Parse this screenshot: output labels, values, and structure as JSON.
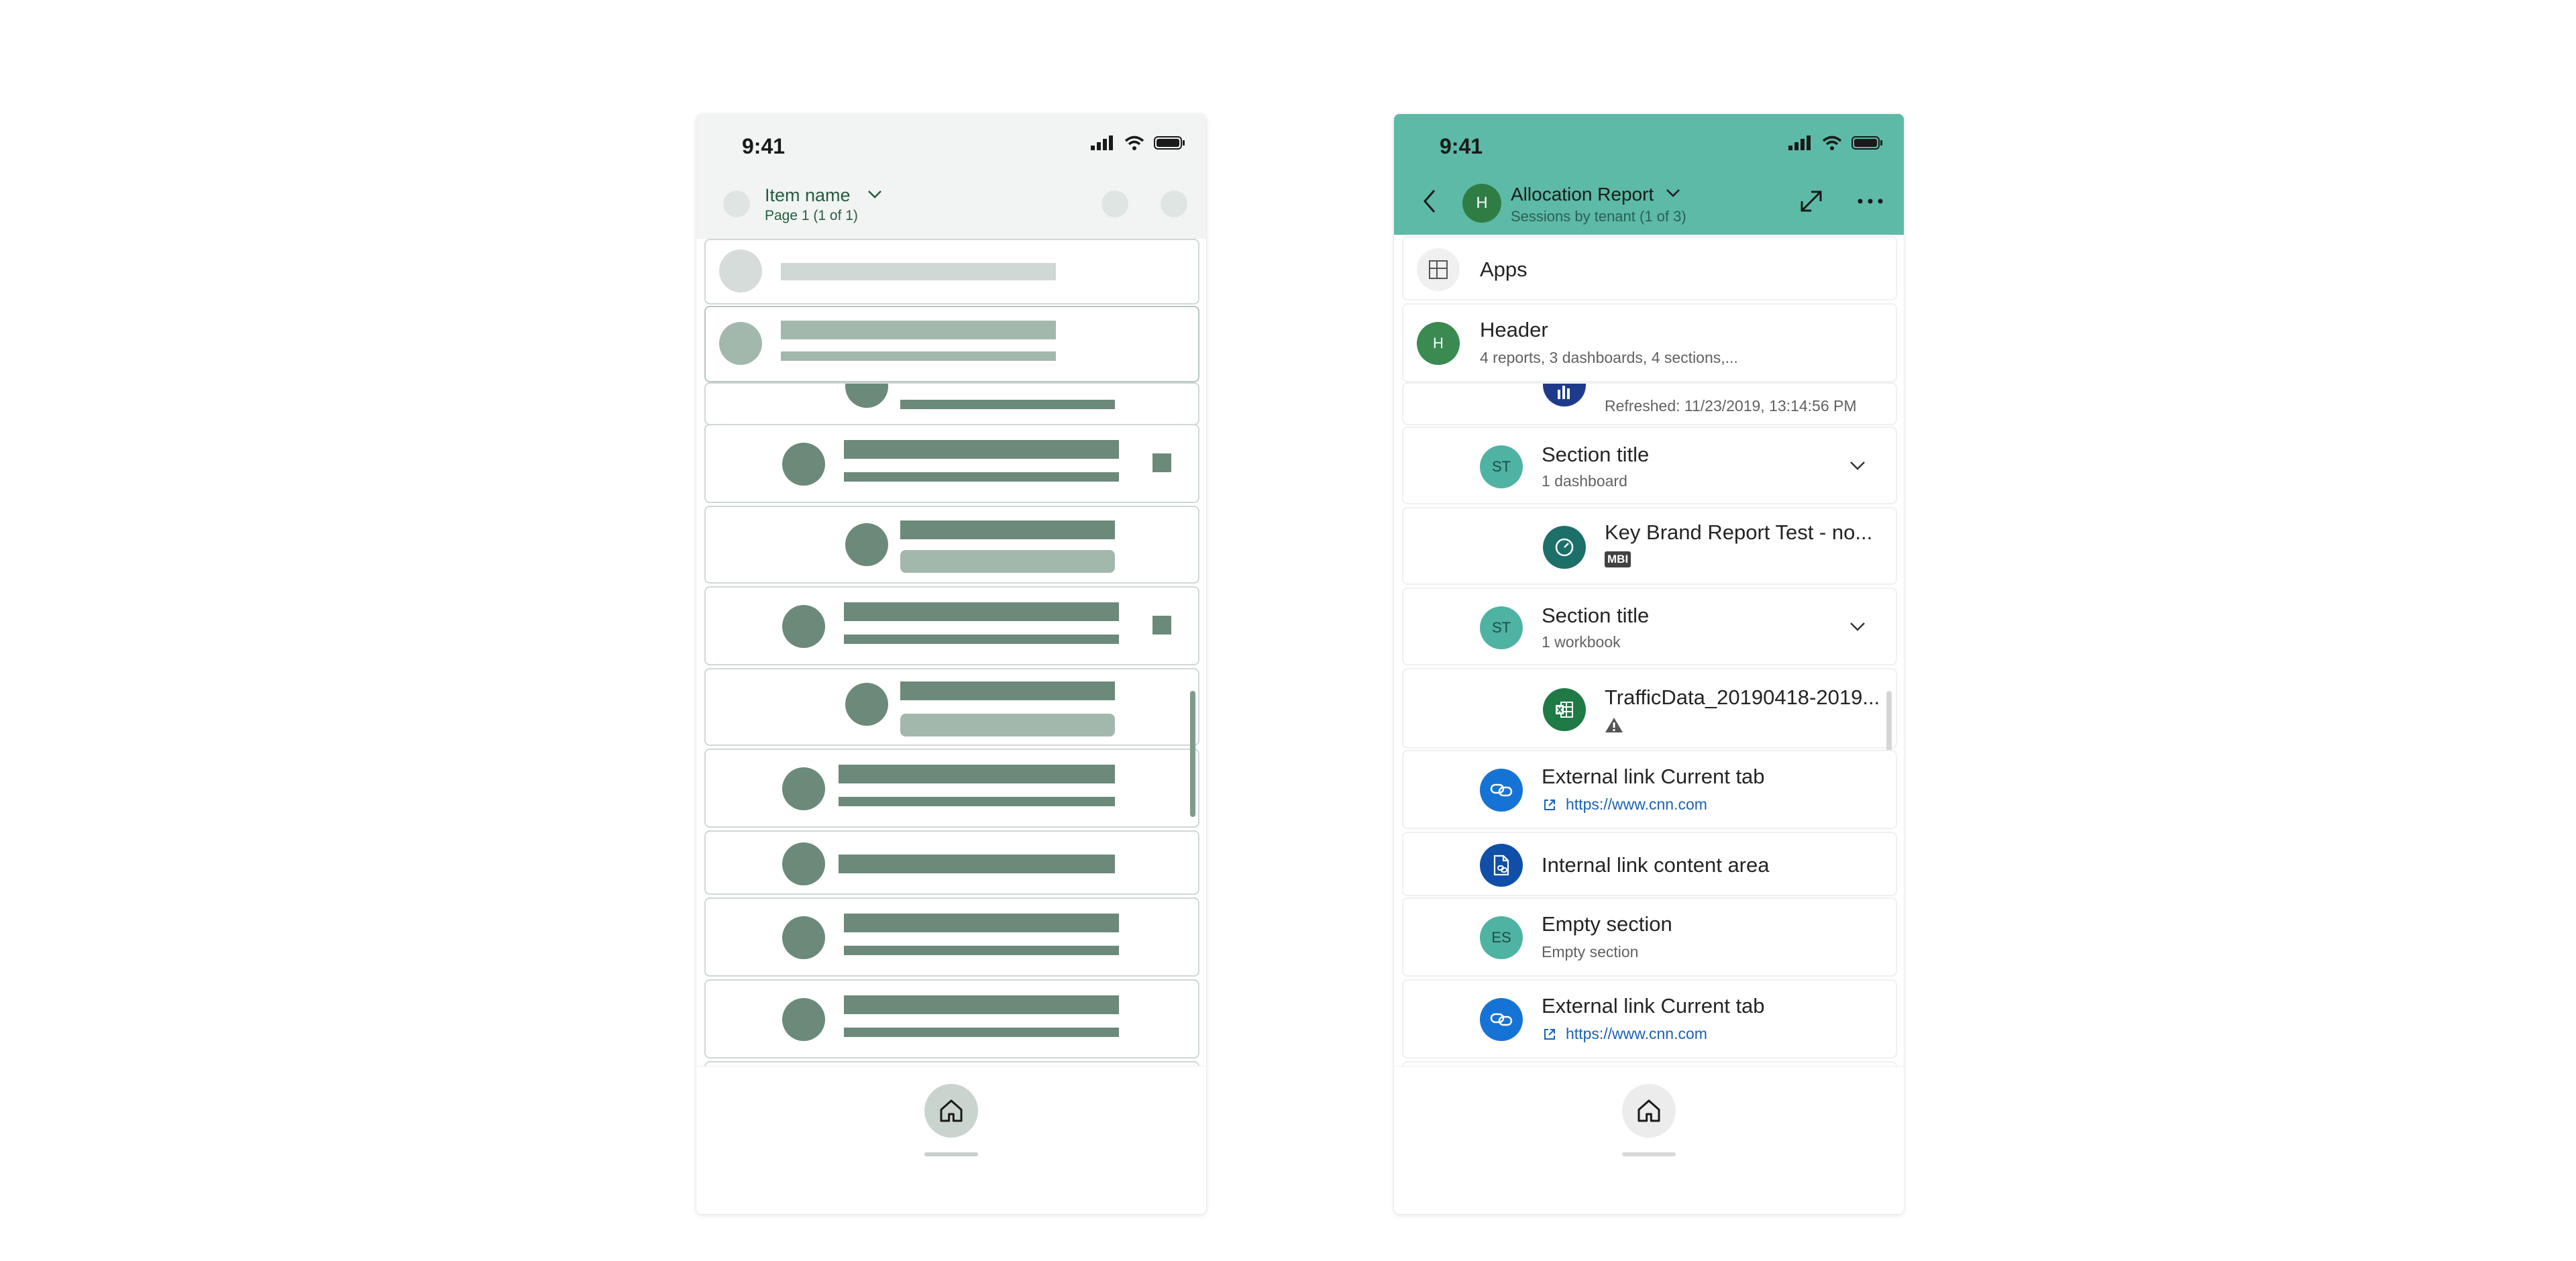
{
  "skeleton": {
    "status_time": "9:41",
    "header_title": "Item name",
    "header_subtitle": "Page 1 (1 of 1)",
    "colors": {
      "header_bg": "#f1f4f3",
      "bar": "#6b8a7a",
      "bar_light": "#a3b8ad",
      "card_border": "#cfd8d4"
    },
    "icons": {
      "home": "home-icon",
      "chevron": "chevron-down-icon"
    }
  },
  "report": {
    "status_time": "9:41",
    "header": {
      "avatar_initial": "H",
      "title": "Allocation Report",
      "subtitle": "Sessions by tenant (1 of 3)"
    },
    "colors": {
      "header_bg": "#5cbaa6",
      "accent_green": "#3a8a52",
      "teal": "#4fb3a3",
      "link": "#1a62b3",
      "navy": "#1e3a8a"
    },
    "pinned": [
      {
        "icon": "apps-icon",
        "title": "Apps"
      },
      {
        "avatar": "H",
        "title": "Header",
        "subtitle": "4 reports, 3 dashboards, 4 sections,..."
      }
    ],
    "items": {
      "partial_report_sub": "Refreshed: 11/23/2019, 13:14:56 PM",
      "section1": {
        "avatar": "ST",
        "title": "Section title",
        "subtitle": "1 dashboard"
      },
      "dashboard": {
        "title": "Key Brand Report Test - no...",
        "badge": "MBI"
      },
      "section2": {
        "avatar": "ST",
        "title": "Section title",
        "subtitle": "1 workbook"
      },
      "workbook": {
        "title": "TrafficData_20190418-2019...",
        "warning": "warning-icon"
      },
      "external1": {
        "title": "External link Current tab",
        "url": "https://www.cnn.com"
      },
      "internal": {
        "title": "Internal link content area"
      },
      "empty": {
        "avatar": "ES",
        "title": "Empty section",
        "subtitle": "Empty section"
      },
      "external2": {
        "title": "External link Current tab",
        "url": "https://www.cnn.com"
      }
    }
  }
}
